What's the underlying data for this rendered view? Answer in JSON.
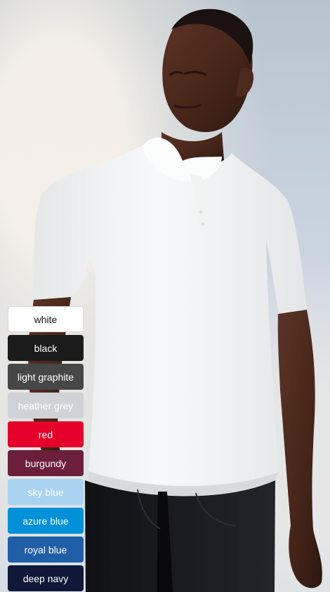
{
  "image": {
    "subject": "man-in-white-polo-shirt"
  },
  "swatches": [
    {
      "label": "white",
      "color": "#ffffff",
      "text_color": "#111111"
    },
    {
      "label": "black",
      "color": "#1b1b1b",
      "text_color": "#ffffff"
    },
    {
      "label": "light graphite",
      "color": "#474747",
      "text_color": "#ffffff"
    },
    {
      "label": "heather grey",
      "color": "#cfd3d7",
      "text_color": "#ffffff"
    },
    {
      "label": "red",
      "color": "#e4002b",
      "text_color": "#ffffff"
    },
    {
      "label": "burgundy",
      "color": "#6b1f3a",
      "text_color": "#ffffff"
    },
    {
      "label": "sky blue",
      "color": "#a9d3f1",
      "text_color": "#ffffff"
    },
    {
      "label": "azure blue",
      "color": "#0091d8",
      "text_color": "#ffffff"
    },
    {
      "label": "royal blue",
      "color": "#205ea8",
      "text_color": "#ffffff"
    },
    {
      "label": "deep navy",
      "color": "#0f1838",
      "text_color": "#ffffff"
    }
  ]
}
